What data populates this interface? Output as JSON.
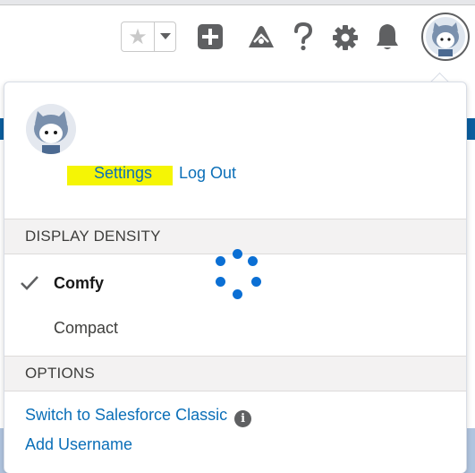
{
  "header": {
    "favorites_icon": "star-icon",
    "favorites_menu_icon": "chevron-down-icon",
    "new_icon": "plus-icon",
    "trailhead_icon": "trailhead-icon",
    "help_icon": "question-icon",
    "setup_icon": "gear-icon",
    "notifications_icon": "bell-icon",
    "avatar_icon": "astro-avatar-icon"
  },
  "profile_menu": {
    "avatar_icon": "astro-avatar-icon",
    "settings_label": "Settings",
    "logout_label": "Log Out",
    "display_density": {
      "heading": "DISPLAY DENSITY",
      "options": [
        {
          "label": "Comfy",
          "selected": true
        },
        {
          "label": "Compact",
          "selected": false
        }
      ]
    },
    "loading_indicator": "spinner",
    "options": {
      "heading": "OPTIONS",
      "switch_classic_label": "Switch to Salesforce Classic",
      "info_icon_text": "i",
      "add_username_label": "Add Username"
    }
  },
  "colors": {
    "link": "#0b6fb8",
    "highlight": "#f5f505",
    "spinner": "#0b6fd4",
    "section_bg": "#f3f2f2"
  }
}
